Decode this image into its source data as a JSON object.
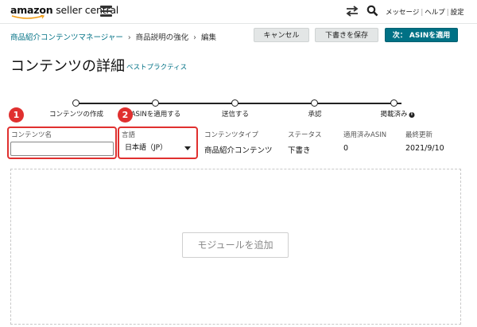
{
  "header": {
    "logo_amazon": "amazon",
    "logo_seller": " seller central",
    "links": [
      "メッセージ",
      "ヘルプ",
      "設定"
    ]
  },
  "breadcrumb": {
    "items": [
      "商品紹介コンテンツマネージャー",
      "商品説明の強化",
      "編集"
    ]
  },
  "actions": {
    "cancel": "キャンセル",
    "save_draft": "下書きを保存",
    "next": "次： ASINを適用"
  },
  "page": {
    "title": "コンテンツの詳細",
    "best_practices": "ベストプラクティス"
  },
  "steps": [
    {
      "label": "コンテンツの作成"
    },
    {
      "label": "ASINを適用する"
    },
    {
      "label": "送信する"
    },
    {
      "label": "承認"
    },
    {
      "label": "掲載済み"
    }
  ],
  "details": {
    "name_label": "コンテンツ名",
    "name_value": "",
    "language_label": "言語",
    "language_value": "日本語（JP）",
    "type_label": "コンテンツタイプ",
    "type_value": "商品紹介コンテンツ",
    "status_label": "ステータス",
    "status_value": "下書き",
    "asin_label": "適用済みASIN",
    "asin_value": "0",
    "updated_label": "最終更新",
    "updated_value": "2021/9/10"
  },
  "annotations": {
    "marker1": "1",
    "marker2": "2",
    "color": "#e0302f"
  },
  "module": {
    "add_label": "モジュールを追加"
  },
  "colors": {
    "accent": "#007185",
    "link": "#007185"
  }
}
